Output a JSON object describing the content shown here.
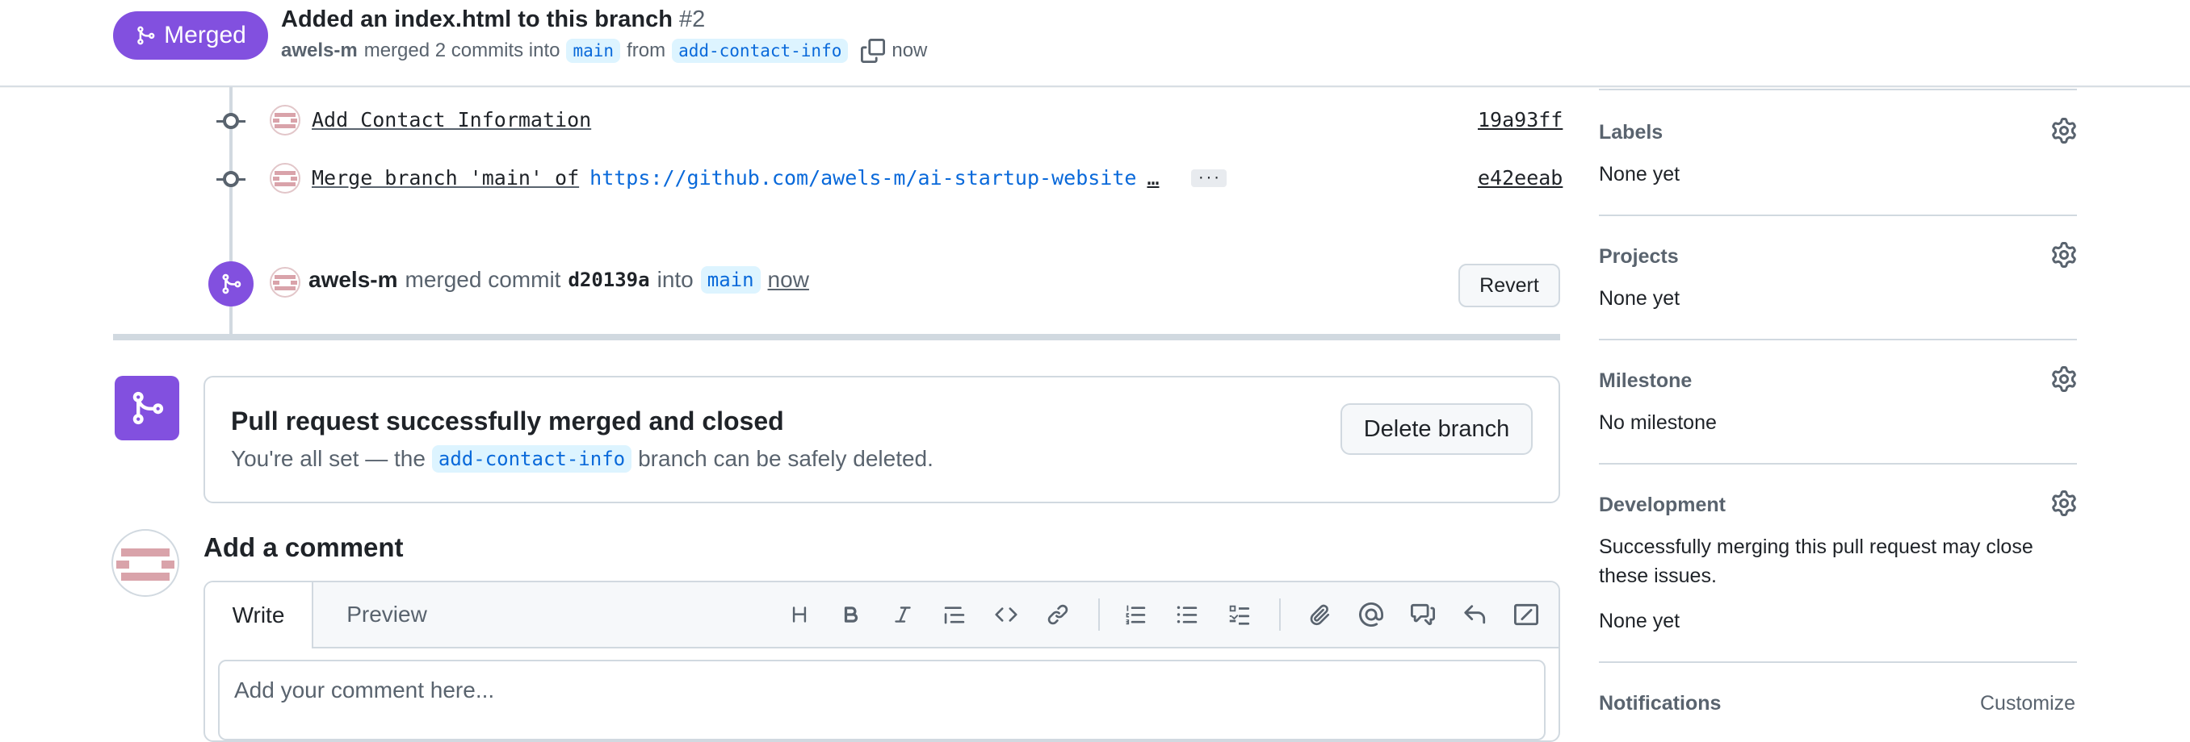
{
  "header": {
    "status": "Merged",
    "title": "Added an index.html to this branch",
    "number": "#2",
    "author": "awels-m",
    "merged_text": "merged 2 commits into",
    "base_branch": "main",
    "from_text": "from",
    "head_branch": "add-contact-info",
    "time": "now"
  },
  "timeline": {
    "commits": [
      {
        "message": "Add Contact Information",
        "sha": "19a93ff"
      },
      {
        "message": "Merge branch 'main' of",
        "link": "https://github.com/awels-m/ai-startup-website",
        "ellipsis": "…",
        "more": "···",
        "sha": "e42eeab"
      }
    ],
    "merge_event": {
      "author": "awels-m",
      "text": "merged commit",
      "commit": "d20139a",
      "into": "into",
      "branch": "main",
      "time": "now",
      "revert_label": "Revert"
    }
  },
  "merged_box": {
    "title": "Pull request successfully merged and closed",
    "desc_prefix": "You're all set — the",
    "branch": "add-contact-info",
    "desc_suffix": "branch can be safely deleted.",
    "delete_label": "Delete branch"
  },
  "comment": {
    "heading": "Add a comment",
    "tab_write": "Write",
    "tab_preview": "Preview",
    "placeholder": "Add your comment here...",
    "toolbar_icons": [
      "heading-icon",
      "bold-icon",
      "italic-icon",
      "quote-icon",
      "code-icon",
      "link-icon",
      "numbered-list-icon",
      "bulleted-list-icon",
      "task-list-icon",
      "attach-icon",
      "mention-icon",
      "reference-icon",
      "reply-icon",
      "slash-command-icon"
    ]
  },
  "sidebar": {
    "labels": {
      "title": "Labels",
      "value": "None yet"
    },
    "projects": {
      "title": "Projects",
      "value": "None yet"
    },
    "milestone": {
      "title": "Milestone",
      "value": "No milestone"
    },
    "development": {
      "title": "Development",
      "desc": "Successfully merging this pull request may close these issues.",
      "value": "None yet"
    },
    "notifications": {
      "title": "Notifications",
      "action": "Customize"
    }
  },
  "colors": {
    "merged": "#8250df",
    "link": "#0969da",
    "muted": "#59636e",
    "border": "#d1d9e0"
  }
}
